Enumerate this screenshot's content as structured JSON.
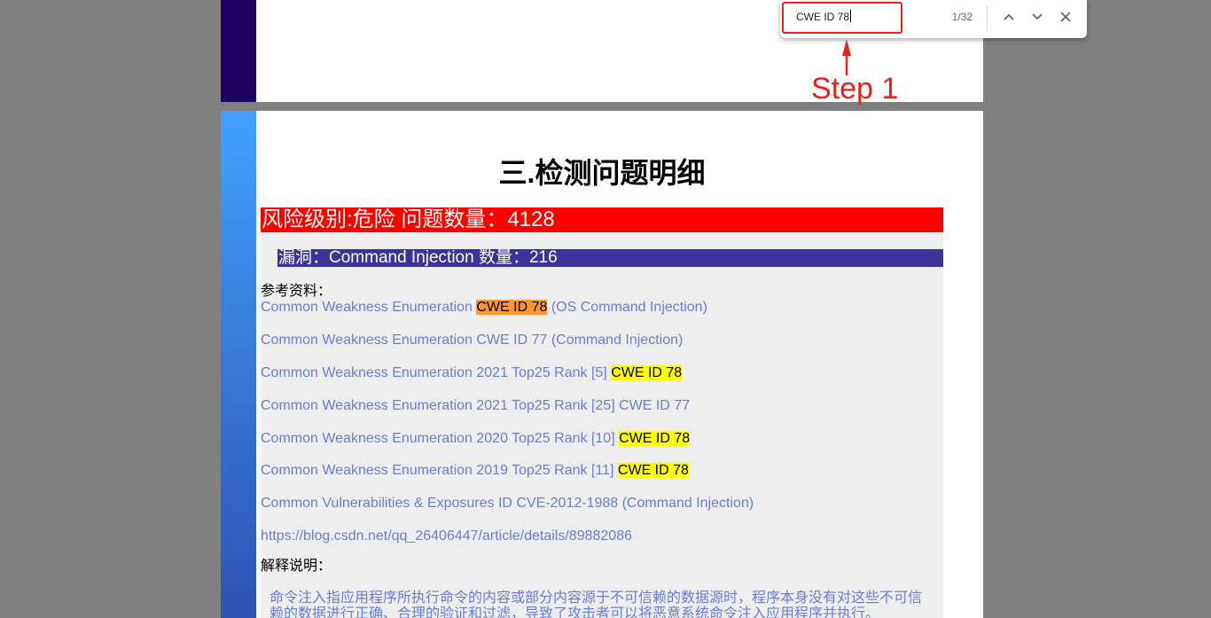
{
  "colors": {
    "viewer_bg": "#808080",
    "page_bg": "#ffffff",
    "page1_strip": "#1f0063",
    "page2_strip_top": "#41a0ff",
    "page2_strip_bottom": "#2d52b3",
    "risk_bar": "#ff0000",
    "vuln_bar": "#3b3399",
    "content_bg": "#eeeeee",
    "link": "#6a7dd6",
    "match_highlight": "#ffff00",
    "active_match_highlight": "#ff9632",
    "annotation": "#e8221b"
  },
  "find_bar": {
    "query": "CWE ID 78",
    "match_count": "1/32",
    "icons": {
      "previous": "chevron-up-icon",
      "next": "chevron-down-icon",
      "close": "close-icon"
    }
  },
  "annotation": {
    "label": "Step 1"
  },
  "report": {
    "section_title": "三.检测问题明细",
    "risk_bar": "风险级别:危险 问题数量：4128",
    "vulnerability_bar": "漏洞：Command Injection 数量：216",
    "references_label": "参考资料：",
    "references": [
      {
        "before": "Common Weakness Enumeration ",
        "active_match": "CWE ID 78",
        "after": " (OS Command Injection)"
      },
      {
        "before": "Common Weakness Enumeration CWE ID 77 (Command Injection)"
      },
      {
        "before": "Common Weakness Enumeration 2021 Top25 Rank [5] ",
        "match": "CWE ID 78"
      },
      {
        "before": "Common Weakness Enumeration 2021 Top25 Rank [25] CWE ID 77"
      },
      {
        "before": "Common Weakness Enumeration 2020 Top25 Rank [10] ",
        "match": "CWE ID 78"
      },
      {
        "before": "Common Weakness Enumeration 2019 Top25 Rank [11] ",
        "match": "CWE ID 78"
      },
      {
        "before": "Common Vulnerabilities & Exposures ID CVE-2012-1988 (Command Injection)"
      },
      {
        "before": "https://blog.csdn.net/qq_26406447/article/details/89882086"
      }
    ],
    "explanation_label": "解释说明：",
    "explanation_text": "命令注入指应用程序所执行命令的内容或部分内容源于不可信赖的数据源时，程序本身没有对这些不可信赖的数据进行正确、合理的验证和过滤，导致了攻击者可以将恶意系统命令注入应用程序并执行。"
  }
}
